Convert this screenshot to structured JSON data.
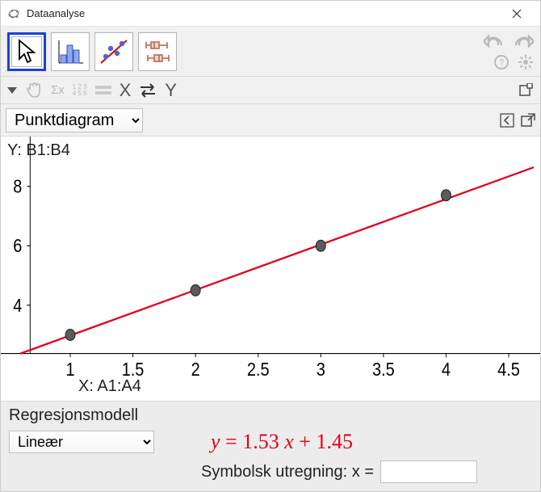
{
  "window": {
    "title": "Dataanalyse",
    "close_label": "Close"
  },
  "toolbar": {
    "tool_pointer": "pointer",
    "tool_barchart": "bar-chart",
    "tool_scatter": "scatter",
    "tool_boxplot": "box-plot",
    "undo": "undo",
    "redo": "redo",
    "help": "help",
    "settings": "settings"
  },
  "subtoolbar": {
    "hand": "pan",
    "sigma": "Σx",
    "digits": "123\n456",
    "rows_icon": "rows",
    "x_label": "X",
    "swap_icon": "swap",
    "y_label": "Y",
    "popout": "popout"
  },
  "chart_type": {
    "selected": "Punktdiagram",
    "options": [
      "Punktdiagram"
    ]
  },
  "chart": {
    "y_axis_label": "Y:  B1:B4",
    "x_axis_label": "X:  A1:A4",
    "y_ticks": [
      "4",
      "6",
      "8"
    ],
    "y_tick_values": [
      4,
      6,
      8
    ],
    "x_ticks": [
      "1",
      "1.5",
      "2",
      "2.5",
      "3",
      "3.5",
      "4",
      "4.5"
    ],
    "x_tick_values": [
      1,
      1.5,
      2,
      2.5,
      3,
      3.5,
      4,
      4.5
    ]
  },
  "chart_data": {
    "type": "scatter",
    "x": [
      1,
      2,
      3,
      4
    ],
    "y": [
      3.0,
      4.5,
      6.0,
      7.7
    ],
    "fit": {
      "type": "linear",
      "slope": 1.53,
      "intercept": 1.45
    },
    "xlabel": "X:  A1:A4",
    "ylabel": "Y:  B1:B4",
    "title": ""
  },
  "regression": {
    "heading": "Regresjonsmodell",
    "selected": "Lineær",
    "options": [
      "Lineær"
    ],
    "formula_y": "y",
    "formula_eq": " = ",
    "formula_slope": "1.53",
    "formula_xsym": " x ",
    "formula_plus": "+ ",
    "formula_intercept": "1.45",
    "symbolic_label": "Symbolsk utregning:  x =",
    "symbolic_value": ""
  }
}
